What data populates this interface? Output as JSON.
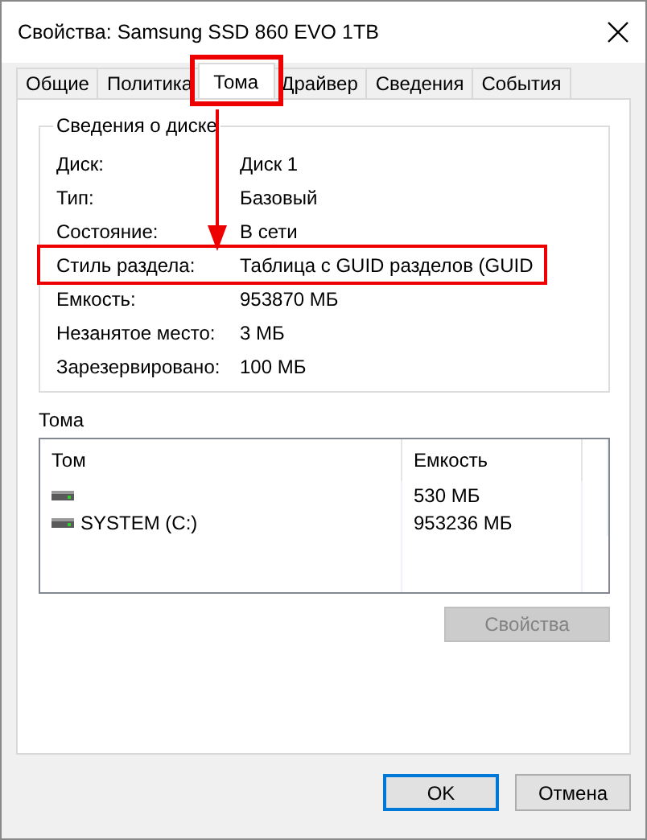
{
  "window": {
    "title": "Свойства: Samsung SSD 860 EVO 1TB"
  },
  "tabs": [
    {
      "label": "Общие",
      "selected": false,
      "annotated": false
    },
    {
      "label": "Политика",
      "selected": false,
      "annotated": false
    },
    {
      "label": "Тома",
      "selected": true,
      "annotated": true
    },
    {
      "label": "Драйвер",
      "selected": false,
      "annotated": false
    },
    {
      "label": "Сведения",
      "selected": false,
      "annotated": false
    },
    {
      "label": "События",
      "selected": false,
      "annotated": false
    }
  ],
  "disk_info": {
    "title": "Сведения о диске",
    "rows": [
      {
        "label": "Диск:",
        "value": "Диск 1",
        "annotated": false
      },
      {
        "label": "Тип:",
        "value": "Базовый",
        "annotated": false
      },
      {
        "label": "Состояние:",
        "value": "В сети",
        "annotated": false
      },
      {
        "label": "Стиль раздела:",
        "value": "Таблица с GUID разделов (GUID",
        "annotated": true
      },
      {
        "label": "Емкость:",
        "value": "953870 МБ",
        "annotated": false
      },
      {
        "label": "Незанятое место:",
        "value": "3 МБ",
        "annotated": false
      },
      {
        "label": "Зарезервировано:",
        "value": "100 МБ",
        "annotated": false
      }
    ]
  },
  "volumes": {
    "title": "Тома",
    "columns": [
      "Том",
      "Емкость"
    ],
    "rows": [
      {
        "name": "",
        "capacity": "530 МБ"
      },
      {
        "name": "SYSTEM (C:)",
        "capacity": "953236 МБ"
      }
    ]
  },
  "properties_button": {
    "label": "Свойства",
    "disabled": true
  },
  "buttons": [
    {
      "label": "OK",
      "default": true
    },
    {
      "label": "Отмена",
      "default": false
    }
  ]
}
